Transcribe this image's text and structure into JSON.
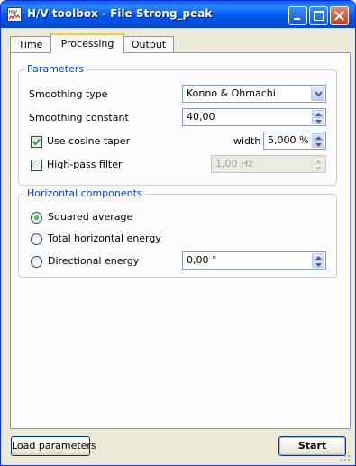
{
  "window": {
    "title": "H/V toolbox - File Strong_peak",
    "app_icon_text": "H/V"
  },
  "tabs": [
    {
      "label": "Time",
      "active": false
    },
    {
      "label": "Processing",
      "active": true
    },
    {
      "label": "Output",
      "active": false
    }
  ],
  "parameters": {
    "title": "Parameters",
    "smoothing_type": {
      "label": "Smoothing type",
      "value": "Konno & Ohmachi"
    },
    "smoothing_constant": {
      "label": "Smoothing constant",
      "value": "40,00"
    },
    "cosine_taper": {
      "label": "Use cosine taper",
      "checked": true,
      "width_label": "width",
      "width_value": "5,000 %"
    },
    "high_pass": {
      "label": "High-pass filter",
      "checked": false,
      "value": "1,00 Hz"
    }
  },
  "horizontal": {
    "title": "Horizontal components",
    "options": [
      {
        "label": "Squared average",
        "selected": true
      },
      {
        "label": "Total horizontal energy",
        "selected": false
      },
      {
        "label": "Directional energy",
        "selected": false
      }
    ],
    "direction_value": "0,00 °"
  },
  "buttons": {
    "load": "Load parameters",
    "start": "Start"
  },
  "colors": {
    "titlebar": "#0058ee",
    "group_title": "#0046d5",
    "tab_highlight": "#ffc83c"
  }
}
